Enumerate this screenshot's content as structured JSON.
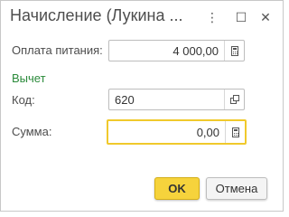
{
  "window": {
    "title": "Начисление (Лукина ...",
    "more_glyph": "⋮",
    "maximize_glyph": "☐",
    "close_glyph": "✕"
  },
  "form": {
    "payment": {
      "label": "Оплата питания:",
      "value": "4 000,00"
    },
    "deduction_group": {
      "label": "Вычет"
    },
    "code": {
      "label": "Код:",
      "value": "620"
    },
    "amount": {
      "label": "Сумма:",
      "value": "0,00"
    }
  },
  "buttons": {
    "ok_label": "OK",
    "cancel_label": "Отмена"
  },
  "colors": {
    "accent": "#f6d33c",
    "group_label": "#2a8a3a",
    "focus_border": "#f0c92c"
  }
}
